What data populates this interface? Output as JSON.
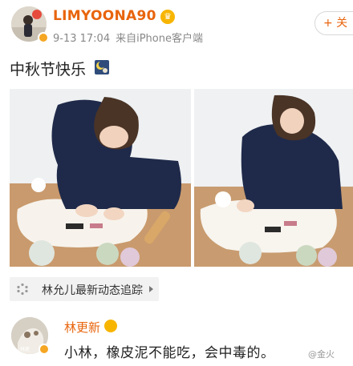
{
  "post": {
    "username": "LIMYOONA90",
    "time": "9-13 17:04",
    "source": "来自iPhone客户端",
    "follow_label": "+ 关",
    "text": "中秋节快乐"
  },
  "photos": [
    {
      "description_icon": "photo-icon"
    },
    {
      "description_icon": "photo-icon"
    }
  ],
  "topic": {
    "label": "林允儿最新动态追踪",
    "icon": "spinner-icon"
  },
  "comment": {
    "author": "林更新",
    "text": "小林，橡皮泥不能吃，会中毒的。"
  },
  "watermark": "@金火",
  "colors": {
    "accent": "#e8640c",
    "badge": "#f5a623",
    "chip_bg": "#f2f2f2"
  }
}
